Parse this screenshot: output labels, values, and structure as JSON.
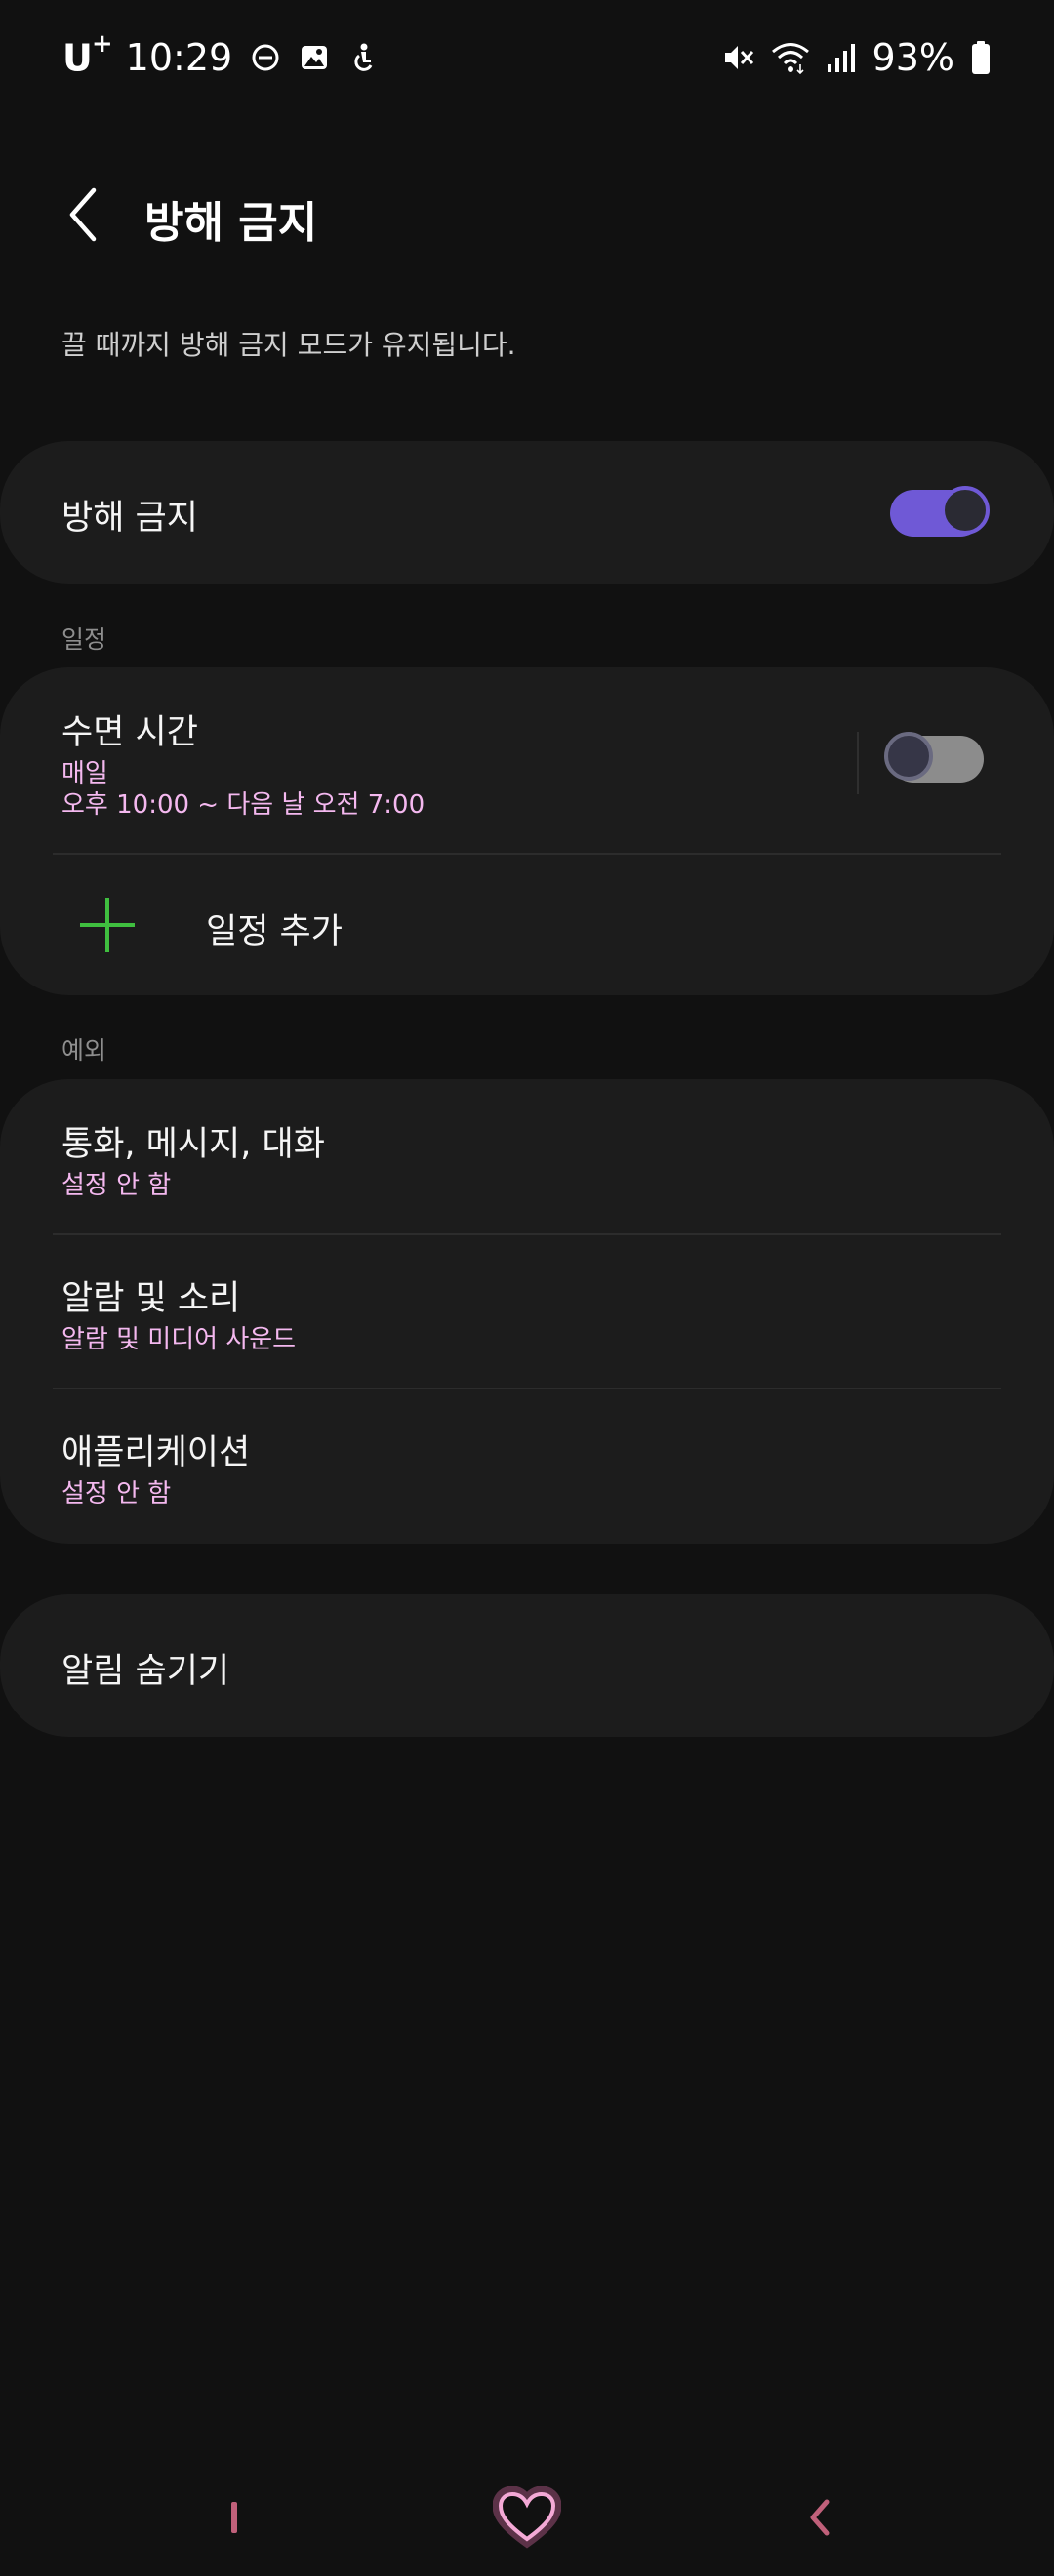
{
  "status_bar": {
    "carrier": "U",
    "carrier_sup": "+",
    "time": "10:29",
    "battery": "93%",
    "icons_left": [
      "dnd-icon",
      "gallery-icon",
      "accessibility-icon"
    ],
    "icons_right": [
      "mute-icon",
      "wifi-icon",
      "signal-icon",
      "battery-icon"
    ]
  },
  "header": {
    "title": "방해 금지",
    "back_icon": "chevron-left-icon"
  },
  "description": "끌 때까지 방해 금지 모드가 유지됩니다.",
  "dnd": {
    "label": "방해 금지",
    "enabled": true
  },
  "schedule": {
    "section_label": "일정",
    "items": [
      {
        "title": "수면 시간",
        "days": "매일",
        "time": "오후 10:00 ~ 다음 날 오전 7:00",
        "enabled": false
      }
    ],
    "add_label": "일정 추가"
  },
  "exceptions": {
    "section_label": "예외",
    "items": [
      {
        "title": "통화, 메시지, 대화",
        "sub": "설정 안 함"
      },
      {
        "title": "알람 및 소리",
        "sub": "알람 및 미디어 사운드"
      },
      {
        "title": "애플리케이션",
        "sub": "설정 안 함"
      }
    ]
  },
  "hide_notifications": {
    "label": "알림 숨기기"
  },
  "nav_bar": {
    "icons": [
      "recents-icon",
      "home-heart-icon",
      "back-icon"
    ]
  },
  "colors": {
    "background": "#111111",
    "card": "#1c1c1c",
    "accent": "#6f59d6",
    "subtext_pink": "#f4b8ef",
    "add_green": "#3fbf3f",
    "nav_pink": "#c0607a"
  }
}
